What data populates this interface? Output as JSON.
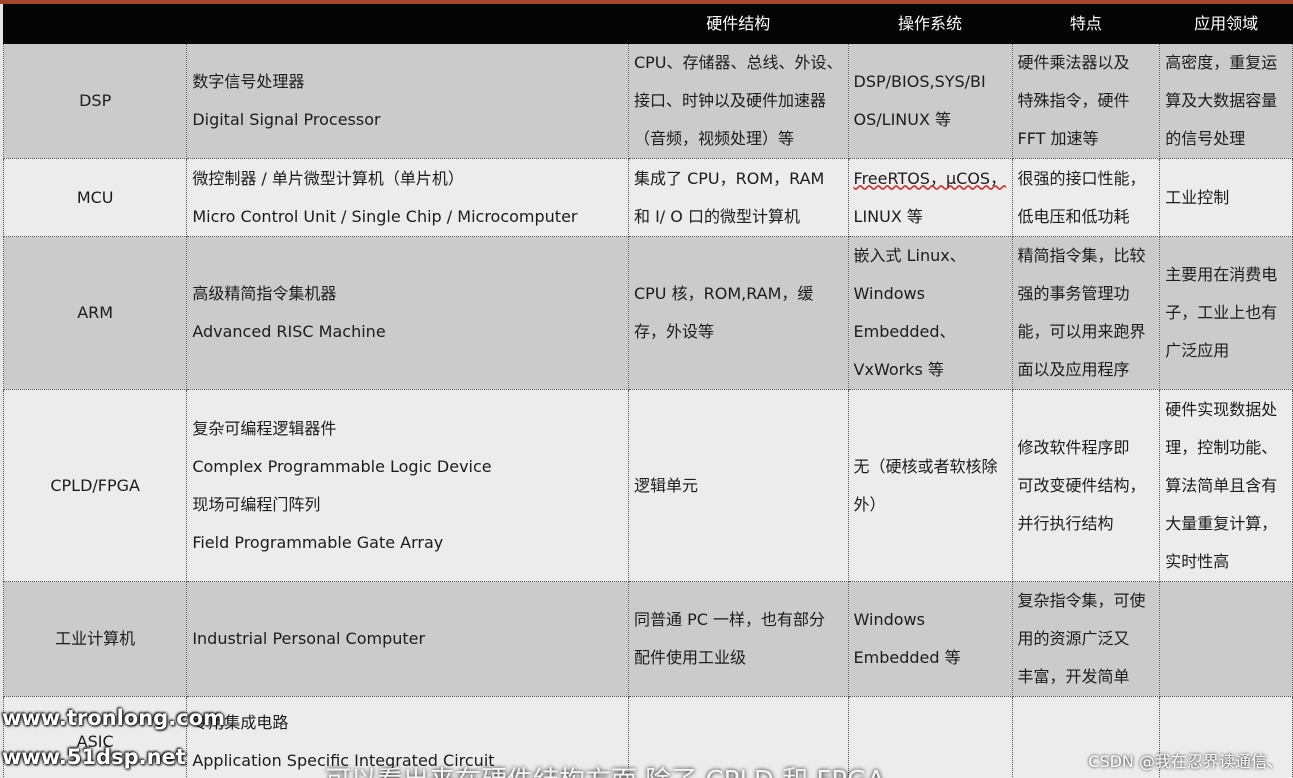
{
  "table": {
    "headers": [
      "",
      "",
      "硬件结构",
      "操作系统",
      "特点",
      "应用领域"
    ],
    "rows": [
      {
        "name": "DSP",
        "desc": [
          "数字信号处理器",
          "Digital Signal Processor"
        ],
        "hardware": [
          "CPU、存储器、总线、外设、",
          "接口、时钟以及硬件加速器",
          "（音频，视频处理）等"
        ],
        "os": [
          "DSP/BIOS,SYS/BI",
          "OS/LINUX 等"
        ],
        "features": [
          "硬件乘法器以及",
          "特殊指令，硬件",
          "FFT 加速等"
        ],
        "apps": [
          "高密度，重复运",
          "算及大数据容量",
          "的信号处理"
        ]
      },
      {
        "name": "MCU",
        "desc": [
          "微控制器 / 单片微型计算机（单片机）",
          "Micro Control Unit / Single Chip / Microcomputer"
        ],
        "hardware": [
          "集成了 CPU，ROM，RAM",
          "和 I/ O 口的微型计算机"
        ],
        "os": [
          "FreeRTOS，μCOS，",
          "LINUX 等"
        ],
        "features": [
          "很强的接口性能，",
          "低电压和低功耗"
        ],
        "apps": [
          "工业控制"
        ]
      },
      {
        "name": "ARM",
        "desc": [
          "高级精简指令集机器",
          "Advanced RISC Machine"
        ],
        "hardware": [
          "CPU 核，ROM,RAM，缓",
          "存，外设等"
        ],
        "os": [
          "嵌入式 Linux、",
          "Windows",
          "Embedded、",
          "VxWorks 等"
        ],
        "features": [
          "精简指令集，比较",
          "强的事务管理功",
          "能，可以用来跑界",
          "面以及应用程序"
        ],
        "apps": [
          "主要用在消费电",
          "子，工业上也有",
          "广泛应用"
        ]
      },
      {
        "name": "CPLD/FPGA",
        "desc": [
          "复杂可编程逻辑器件",
          "Complex Programmable Logic Device",
          "现场可编程门阵列",
          "Field Programmable Gate Array"
        ],
        "hardware": [
          "逻辑单元"
        ],
        "os": [
          "无（硬核或者软核除",
          "外）"
        ],
        "features": [
          "修改软件程序即",
          "可改变硬件结构，",
          "并行执行结构"
        ],
        "apps": [
          "硬件实现数据处",
          "理，控制功能、",
          "算法简单且含有",
          "大量重复计算，",
          "实时性高"
        ]
      },
      {
        "name": "工业计算机",
        "desc": [
          "Industrial Personal Computer"
        ],
        "hardware": [
          "同普通 PC 一样，也有部分",
          "配件使用工业级"
        ],
        "os": [
          "Windows",
          "Embedded 等"
        ],
        "features": [
          "复杂指令集，可使",
          "用的资源广泛又",
          "丰富，开发简单"
        ],
        "apps": []
      },
      {
        "name": "ASIC",
        "desc": [
          "专用集成电路",
          "Application Specific Integrated Circuit"
        ],
        "hardware": [],
        "os": [],
        "features": [],
        "apps": []
      }
    ]
  },
  "watermarks": {
    "site1": "www.tronlong.com",
    "site2": "www.51dsp.net",
    "csdn": "CSDN @我在忍界读通信、",
    "caption": "可以看出来在硬件结构方面 除了 CPLD 和 FPGA"
  },
  "colors": {
    "header_bg": "#050505",
    "row_dark": "#cbcbcb",
    "row_light": "#ececec",
    "top_accent": "#a5442c"
  }
}
